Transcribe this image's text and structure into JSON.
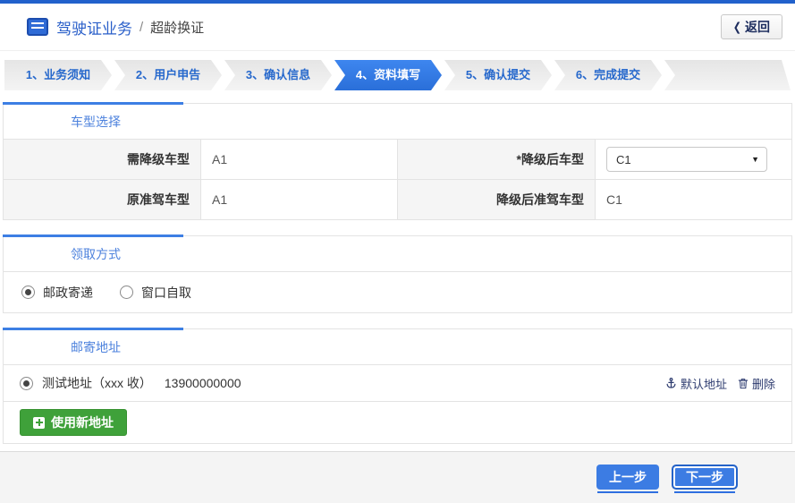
{
  "colors": {
    "accent_blue": "#2161cc",
    "active_step_blue": "#2f7ae4",
    "section_title_blue": "#4d82dd",
    "green_button": "#3fa13a",
    "footer_button_blue": "#3c7ce3"
  },
  "icons": {
    "back_chevron": "❮",
    "caret_down": "▼",
    "separator": "/"
  },
  "header": {
    "title": "驾驶证业务",
    "separator": "/",
    "subtitle": "超龄换证",
    "back_label": "返回"
  },
  "steps": [
    {
      "label": "1、业务须知",
      "active": false
    },
    {
      "label": "2、用户申告",
      "active": false
    },
    {
      "label": "3、确认信息",
      "active": false
    },
    {
      "label": "4、资料填写",
      "active": true
    },
    {
      "label": "5、确认提交",
      "active": false
    },
    {
      "label": "6、完成提交",
      "active": false
    }
  ],
  "sections": {
    "vehicle": {
      "title": "车型选择",
      "rows": [
        {
          "label1": "需降级车型",
          "value1": "A1",
          "label2": "*降级后车型",
          "value2": "C1",
          "value2_control": "select"
        },
        {
          "label1": "原准驾车型",
          "value1": "A1",
          "label2": "降级后准驾车型",
          "value2": "C1",
          "value2_control": "text"
        }
      ]
    },
    "pickup": {
      "title": "领取方式",
      "options": [
        {
          "label": "邮政寄递",
          "selected": true
        },
        {
          "label": "窗口自取",
          "selected": false
        }
      ]
    },
    "address": {
      "title": "邮寄地址",
      "entry": {
        "selected": true,
        "name": "测试地址（xxx 收）",
        "phone": "13900000000"
      },
      "links": {
        "default_label": "默认地址",
        "delete_label": "删除"
      },
      "add_button_label": "使用新地址"
    }
  },
  "footer": {
    "prev_label": "上一步",
    "next_label": "下一步"
  }
}
